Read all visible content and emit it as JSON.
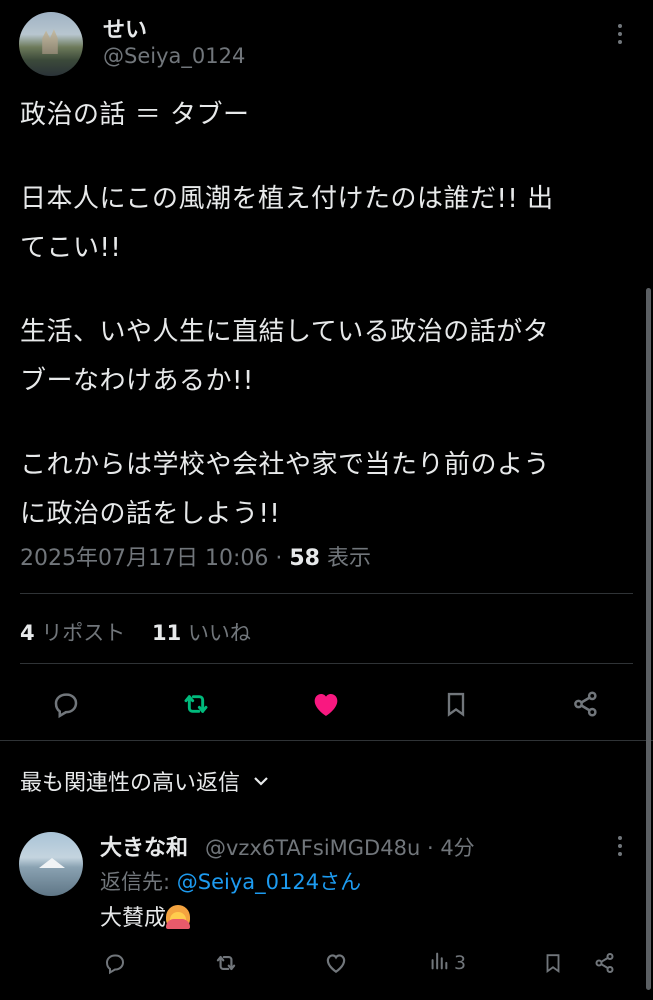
{
  "post": {
    "author_name": "せい",
    "author_handle": "@Seiya_0124",
    "text_lines": [
      "政治の話 ＝ タブー",
      "日本人にこの風潮を植え付けたのは誰だ!! 出",
      "てこい!!",
      "生活、いや人生に直結している政治の話がタ",
      "ブーなわけあるか!!",
      "これからは学校や会社や家で当たり前のよう",
      "に政治の話をしよう!!"
    ],
    "timestamp": "2025年07月17日 10:06",
    "separator": "·",
    "views_count": "58",
    "views_label": "表示",
    "reposts_count": "4",
    "reposts_label": "リポスト",
    "likes_count": "11",
    "likes_label": "いいね",
    "liked": true,
    "accent_colors": {
      "retweet": "#00ba7c",
      "like": "#f91880",
      "link": "#1d9bf0"
    }
  },
  "replies_sort": {
    "label": "最も関連性の高い返信"
  },
  "reply": {
    "author_name": "大きな和",
    "author_handle": "@vzx6TAFsiMGD48u",
    "separator": "·",
    "time_ago": "4分",
    "reply_to_prefix": "返信先:",
    "reply_to_handle": "@Seiya_0124さん",
    "text": "大賛成",
    "views_count": "3"
  }
}
